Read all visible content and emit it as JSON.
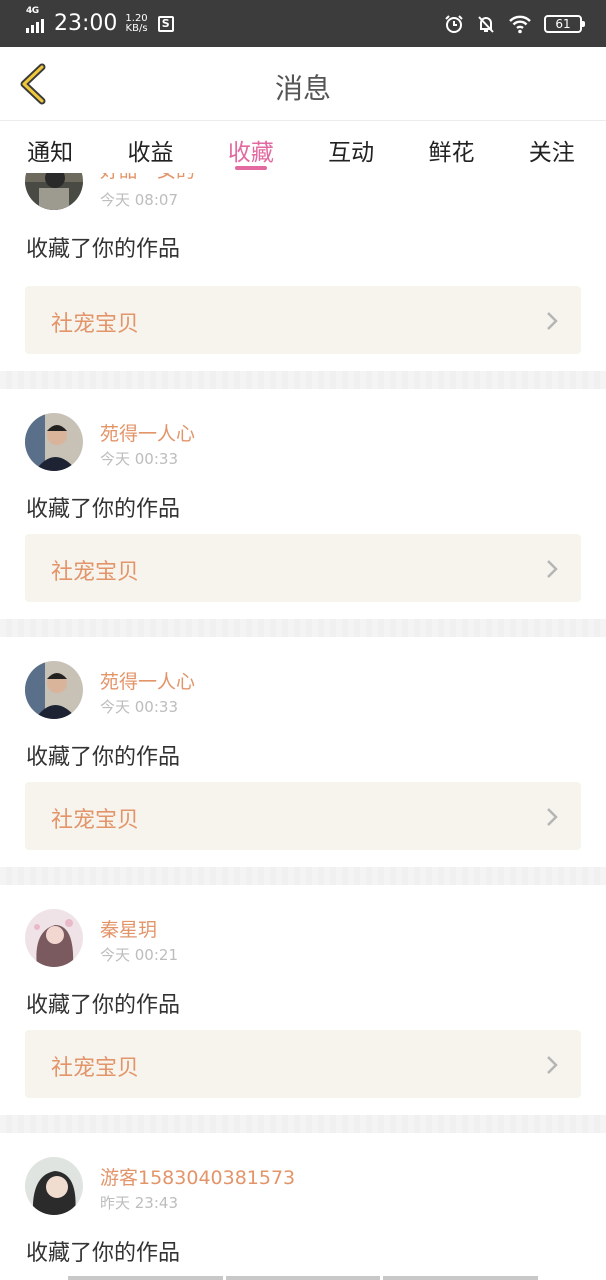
{
  "status_bar": {
    "network": "4G",
    "time": "23:00",
    "speed_value": "1.20",
    "speed_unit": "KB/s",
    "battery": "61",
    "icons": [
      "signal-icon",
      "s-app-icon",
      "alarm-icon",
      "mute-bell-icon",
      "wifi-icon",
      "battery-icon"
    ]
  },
  "header": {
    "title": "消息",
    "back_icon": "chevron-left-icon"
  },
  "tabs": [
    {
      "label": "通知",
      "active": false
    },
    {
      "label": "收益",
      "active": false
    },
    {
      "label": "收藏",
      "active": true
    },
    {
      "label": "互动",
      "active": false
    },
    {
      "label": "鲜花",
      "active": false
    },
    {
      "label": "关注",
      "active": false
    }
  ],
  "colors": {
    "accent_pink": "#e26aa0",
    "username_orange": "#e3956a",
    "work_box_bg": "#f7f4ee"
  },
  "messages": [
    {
      "username": "好甜一女的",
      "time": "今天 08:07",
      "action": "收藏了你的作品",
      "work": "社宠宝贝"
    },
    {
      "username": "苑得一人心",
      "time": "今天 00:33",
      "action": "收藏了你的作品",
      "work": "社宠宝贝"
    },
    {
      "username": "苑得一人心",
      "time": "今天 00:33",
      "action": "收藏了你的作品",
      "work": "社宠宝贝"
    },
    {
      "username": "秦星玥",
      "time": "今天 00:21",
      "action": "收藏了你的作品",
      "work": "社宠宝贝"
    },
    {
      "username": "游客1583040381573",
      "time": "昨天 23:43",
      "action": "收藏了你的作品",
      "work": ""
    }
  ]
}
